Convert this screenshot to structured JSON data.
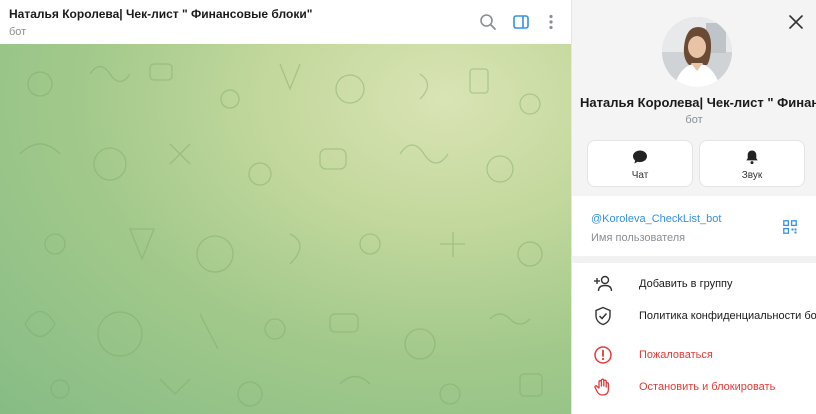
{
  "chat": {
    "title": "Наталья Королева| Чек-лист \" Финансовые блоки\"",
    "subtitle": "бот"
  },
  "panel": {
    "name": "Наталья Королева| Чек-лист \" Финансовые блоки\"",
    "subtitle": "бот",
    "actions": [
      {
        "label": "Чат",
        "icon": "chat-bubble-icon"
      },
      {
        "label": "Звук",
        "icon": "bell-icon"
      }
    ],
    "username": "@Koroleva_CheckList_bot",
    "username_caption": "Имя пользователя",
    "menu": [
      {
        "label": "Добавить в группу",
        "icon": "add-user-icon"
      },
      {
        "label": "Политика конфиденциальности бота",
        "icon": "shield-check-icon"
      },
      {
        "label": "Пожаловаться",
        "icon": "report-icon",
        "danger": true
      },
      {
        "label": "Остановить и блокировать",
        "icon": "stop-hand-icon",
        "danger": true
      }
    ]
  },
  "colors": {
    "accent": "#3390ec",
    "danger": "#e53935",
    "wallpaper": "#a9cc8c"
  }
}
